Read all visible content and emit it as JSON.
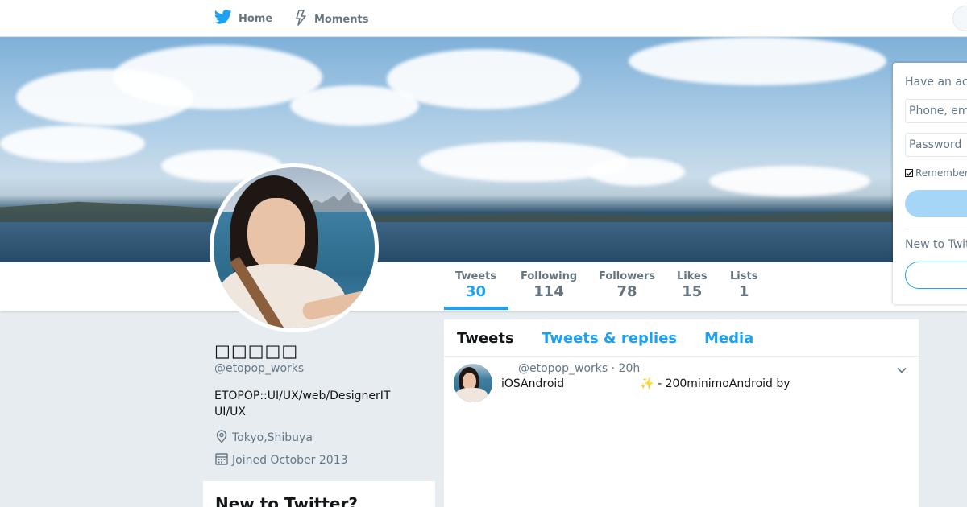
{
  "nav": {
    "home_label": "Home",
    "moments_label": "Moments"
  },
  "colors": {
    "accent": "#1da1f2",
    "background": "#e6ecf0",
    "text_primary": "#14171a",
    "text_secondary": "#657786"
  },
  "profile": {
    "name": "□□□□□",
    "handle": "@etopop_works",
    "bio_line1": "ETOPOP::UI/UX/web/DesignerIT",
    "bio_line2": "UI/UX",
    "location": "Tokyo,Shibuya",
    "joined": "Joined October 2013"
  },
  "stats": [
    {
      "label": "Tweets",
      "value": "30",
      "active": true
    },
    {
      "label": "Following",
      "value": "114",
      "active": false
    },
    {
      "label": "Followers",
      "value": "78",
      "active": false
    },
    {
      "label": "Likes",
      "value": "15",
      "active": false
    },
    {
      "label": "Lists",
      "value": "1",
      "active": false
    }
  ],
  "timeline": {
    "tabs": [
      {
        "label": "Tweets",
        "active": true
      },
      {
        "label": "Tweets & replies",
        "active": false
      },
      {
        "label": "Media",
        "active": false
      }
    ],
    "tweet": {
      "header": "@etopop_works · 20h",
      "text_part1": "iOSAndroid",
      "emoji": "✨",
      "text_part2": " - 200minimoAndroid by"
    }
  },
  "login": {
    "title": "Have an account?",
    "phone_placeholder": "Phone, email or username",
    "password_placeholder": "Password",
    "remember_label": "Remember me",
    "new_label": "New to Twitter?"
  },
  "new_card": {
    "title": "New to Twitter?"
  }
}
